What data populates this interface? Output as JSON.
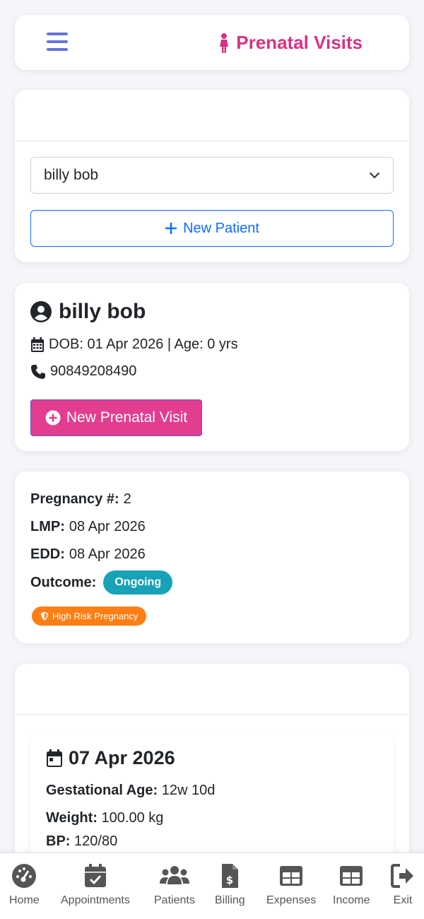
{
  "header": {
    "title": "Prenatal Visits",
    "accent": "#d63384"
  },
  "patient_select": {
    "selected": "billy bob",
    "new_patient_label": "New Patient"
  },
  "patient": {
    "name": "billy bob",
    "dob_line": "DOB: 01 Apr 2026 | Age: 0 yrs",
    "phone": "90849208490",
    "new_visit_label": "New Prenatal Visit"
  },
  "pregnancy": {
    "number_label": "Pregnancy #:",
    "number_value": "2",
    "lmp_label": "LMP:",
    "lmp_value": "08 Apr 2026",
    "edd_label": "EDD:",
    "edd_value": "08 Apr 2026",
    "outcome_label": "Outcome:",
    "outcome_value": "Ongoing",
    "risk_badge": "High Risk Pregnancy"
  },
  "visit": {
    "date": "07 Apr 2026",
    "ga_label": "Gestational Age:",
    "ga_value": "12w 10d",
    "weight_label": "Weight:",
    "weight_value": "100.00 kg",
    "bp_label": "BP:",
    "bp_value": "120/80"
  },
  "nav": {
    "home": "Home",
    "appointments": "Appointments",
    "patients": "Patients",
    "billing": "Billing",
    "expenses": "Expenses",
    "income": "Income",
    "exit": "Exit"
  }
}
